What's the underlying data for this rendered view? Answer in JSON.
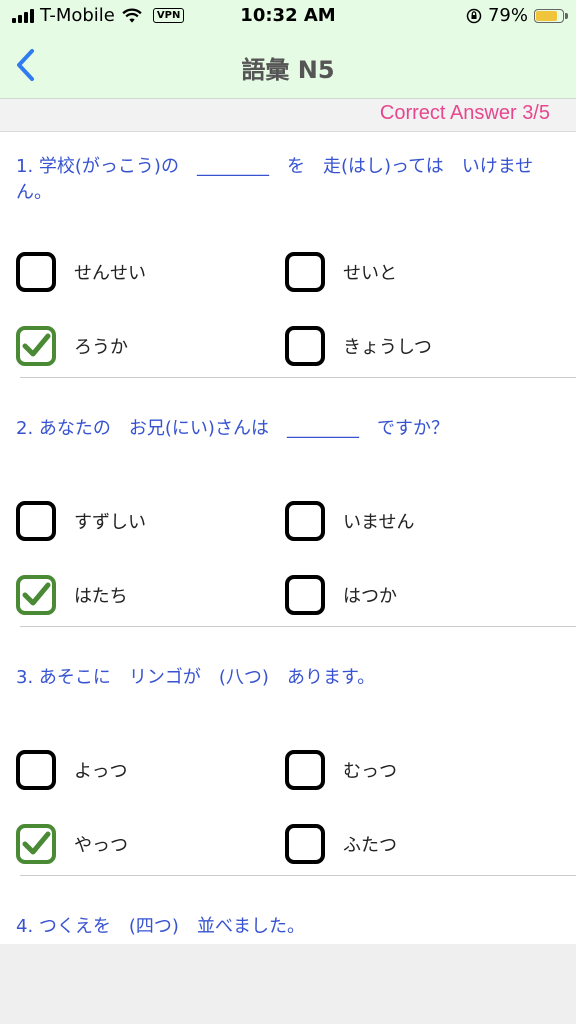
{
  "status_bar": {
    "carrier": "T-Mobile",
    "vpn": "VPN",
    "time": "10:32 AM",
    "battery": "79%",
    "battery_level": 0.79
  },
  "nav": {
    "title": "語彙 N5"
  },
  "score": {
    "label": "Correct Answer 3/5"
  },
  "questions": [
    {
      "text": "1. 学校(がっこう)の　________　を　走(はし)っては　いけません。",
      "options": [
        {
          "label": "せんせい",
          "checked": false
        },
        {
          "label": "せいと",
          "checked": false
        },
        {
          "label": "ろうか",
          "checked": true
        },
        {
          "label": "きょうしつ",
          "checked": false
        }
      ]
    },
    {
      "text": "2. あなたの　お兄(にい)さんは　________　ですか？",
      "options": [
        {
          "label": "すずしい",
          "checked": false
        },
        {
          "label": "いません",
          "checked": false
        },
        {
          "label": "はたち",
          "checked": true
        },
        {
          "label": "はつか",
          "checked": false
        }
      ]
    },
    {
      "text": "3.  あそこに　リンゴが　(八つ)　あります。",
      "options": [
        {
          "label": "よっつ",
          "checked": false
        },
        {
          "label": "むっつ",
          "checked": false
        },
        {
          "label": "やっつ",
          "checked": true
        },
        {
          "label": "ふたつ",
          "checked": false
        }
      ]
    },
    {
      "text": "4. つくえを　(四つ)　並べました。"
    }
  ]
}
